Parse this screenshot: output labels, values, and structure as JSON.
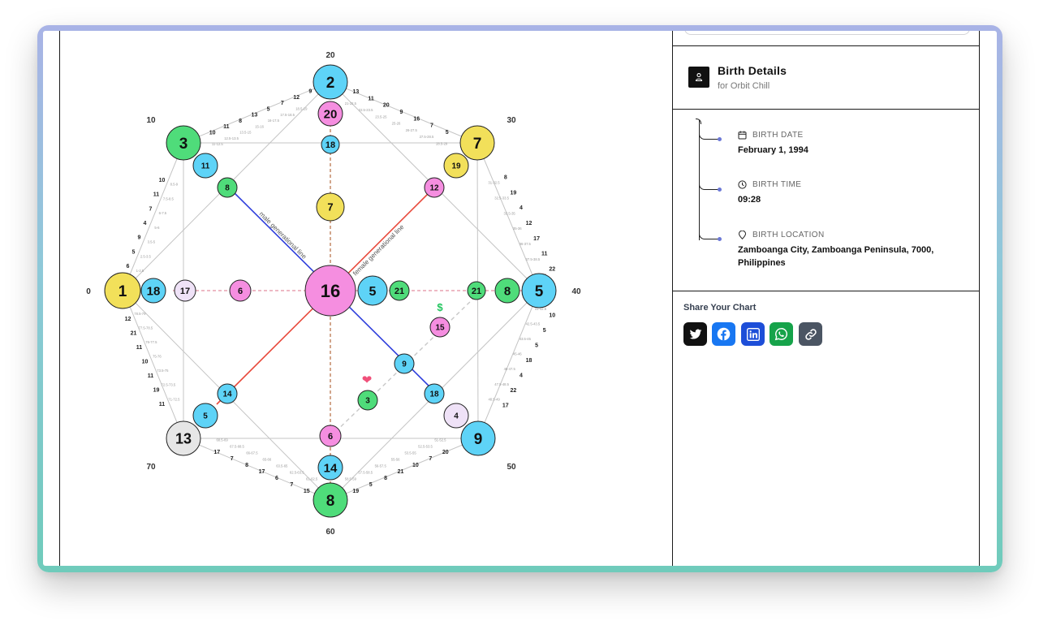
{
  "birth_details": {
    "title": "Birth Details",
    "subtitle": "for Orbit Chill",
    "items": [
      {
        "label": "BIRTH DATE",
        "value": "February 1, 1994",
        "icon": "calendar-icon"
      },
      {
        "label": "BIRTH TIME",
        "value": "09:28",
        "icon": "clock-icon"
      },
      {
        "label": "BIRTH LOCATION",
        "value": "Zamboanga City, Zamboanga Peninsula, 7000, Philippines",
        "icon": "map-pin-icon"
      }
    ]
  },
  "share": {
    "title": "Share Your Chart",
    "buttons": [
      {
        "name": "twitter",
        "color": "#111111"
      },
      {
        "name": "facebook",
        "color": "#1877f2"
      },
      {
        "name": "linkedin",
        "color": "#1d4ed8"
      },
      {
        "name": "whatsapp",
        "color": "#16a34a"
      },
      {
        "name": "copy-link",
        "color": "#4b5563"
      }
    ]
  },
  "chart": {
    "colors": {
      "blue": "#5ed3f7",
      "pink": "#f58ee0",
      "yellow": "#f2e05a",
      "green": "#4fdc7a",
      "lavender": "#efe2f7",
      "gray": "#e6e6e6"
    },
    "age_labels": [
      "0",
      "10",
      "20",
      "30",
      "40",
      "50",
      "60",
      "70"
    ],
    "line_labels": {
      "male": "male generational line",
      "female": "female generational line"
    },
    "symbols": {
      "love": "❤",
      "money": "$"
    },
    "nodes": [
      {
        "name": "1",
        "value": "1",
        "color": "yellow"
      },
      {
        "name": "2",
        "value": "2",
        "color": "blue"
      },
      {
        "name": "3",
        "value": "3",
        "color": "green"
      },
      {
        "name": "7",
        "value": "7",
        "color": "yellow"
      },
      {
        "name": "5",
        "value": "5",
        "color": "blue"
      },
      {
        "name": "9",
        "value": "9",
        "color": "blue"
      },
      {
        "name": "8",
        "value": "8",
        "color": "green"
      },
      {
        "name": "13",
        "value": "13",
        "color": "gray"
      },
      {
        "name": "center",
        "value": "16",
        "color": "pink"
      },
      {
        "name": "top-2",
        "value": "20",
        "color": "pink"
      },
      {
        "name": "top-3",
        "value": "18",
        "color": "blue"
      },
      {
        "name": "top-4",
        "value": "7",
        "color": "yellow"
      },
      {
        "name": "bottom-2",
        "value": "14",
        "color": "blue"
      },
      {
        "name": "bottom-3",
        "value": "6",
        "color": "pink"
      },
      {
        "name": "left-2",
        "value": "18",
        "color": "blue"
      },
      {
        "name": "left-3",
        "value": "17",
        "color": "lavender"
      },
      {
        "name": "left-4",
        "value": "6",
        "color": "pink"
      },
      {
        "name": "right-2",
        "value": "8",
        "color": "green"
      },
      {
        "name": "right-3",
        "value": "21",
        "color": "green"
      },
      {
        "name": "right-center",
        "value": "5",
        "color": "blue"
      },
      {
        "name": "right-center-2",
        "value": "21",
        "color": "green"
      },
      {
        "name": "tl-2",
        "value": "11",
        "color": "blue"
      },
      {
        "name": "tl-3",
        "value": "8",
        "color": "green"
      },
      {
        "name": "tr-2",
        "value": "19",
        "color": "yellow"
      },
      {
        "name": "tr-3",
        "value": "12",
        "color": "pink"
      },
      {
        "name": "br-2",
        "value": "4",
        "color": "lavender"
      },
      {
        "name": "br-3",
        "value": "18",
        "color": "blue"
      },
      {
        "name": "br-4",
        "value": "9",
        "color": "blue"
      },
      {
        "name": "bl-2",
        "value": "5",
        "color": "blue"
      },
      {
        "name": "bl-3",
        "value": "14",
        "color": "blue"
      },
      {
        "name": "money",
        "value": "15",
        "color": "pink"
      },
      {
        "name": "love",
        "value": "3",
        "color": "green"
      }
    ],
    "ticks": {
      "top_left_outer": [
        "10",
        "11",
        "8",
        "13",
        "5",
        "7",
        "12",
        "9"
      ],
      "top_left_inner": [
        "11-12.5",
        "12.5-13.5",
        "13.5-15",
        "15-16",
        "16-17.5",
        "17.5-18.5",
        "18.5-19"
      ],
      "top_right_outer": [
        "13",
        "11",
        "20",
        "9",
        "16",
        "7",
        "5"
      ],
      "top_right_inner": [
        "21-22.5",
        "22.5-23.5",
        "23.5-25",
        "25-26",
        "26-27.5",
        "27.5-28.5",
        "28.5-29"
      ],
      "right_upper_outer": [
        "8",
        "19",
        "4",
        "12",
        "17",
        "11",
        "22"
      ],
      "right_upper_inner": [
        "31-32.5",
        "32.5-33.5",
        "33.5-35",
        "35-36",
        "36-37.5",
        "37.5-38.5",
        "38.5-39"
      ],
      "right_lower_outer": [
        "10",
        "5",
        "5",
        "18",
        "4",
        "22",
        "17"
      ],
      "right_lower_inner": [
        "41-42.5",
        "42.5-43.5",
        "43.5-45",
        "45-46",
        "46-47.5",
        "47.5-48.5",
        "48.5-49"
      ],
      "bottom_right_outer": [
        "20",
        "7",
        "10",
        "21",
        "8",
        "5",
        "19"
      ],
      "bottom_right_inner": [
        "51-52.5",
        "52.5-53.5",
        "53.5-55",
        "55-56",
        "56-57.5",
        "57.5-58.5",
        "58.5-59"
      ],
      "bottom_left_outer": [
        "17",
        "7",
        "8",
        "17",
        "6",
        "7",
        "15"
      ],
      "bottom_left_inner": [
        "68.5-69",
        "67.5-68.5",
        "66-67.5",
        "65-66",
        "63.5-65",
        "62.5-63.5",
        "61-62.5"
      ],
      "left_lower_outer": [
        "12",
        "21",
        "11",
        "10",
        "11",
        "19",
        "11"
      ],
      "left_lower_inner": [
        "78.5-79",
        "77.5-78.5",
        "76-77.5",
        "75-76",
        "73.5-75",
        "72.5-73.5",
        "71-72.5"
      ],
      "left_upper_outer": [
        "10",
        "11",
        "7",
        "4",
        "9",
        "5",
        "6"
      ],
      "left_upper_inner": [
        "8.5-9",
        "7.5-8.5",
        "6-7.5",
        "5-6",
        "3.5-5",
        "2.5-3.5",
        "1-2.5"
      ]
    }
  }
}
